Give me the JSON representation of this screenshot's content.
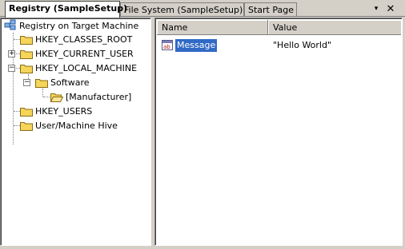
{
  "tabs": [
    {
      "label": "Registry (SampleSetup)",
      "active": true
    },
    {
      "label": "File System (SampleSetup)",
      "active": false
    },
    {
      "label": "Start Page",
      "active": false
    }
  ],
  "tab_controls": {
    "dropdown_icon": "▾",
    "close_icon": "✕"
  },
  "tree": {
    "root": "Registry on Target Machine",
    "items": [
      {
        "label": "HKEY_CLASSES_ROOT",
        "expander": ""
      },
      {
        "label": "HKEY_CURRENT_USER",
        "expander": "+"
      },
      {
        "label": "HKEY_LOCAL_MACHINE",
        "expander": "−"
      },
      {
        "label": "Software",
        "expander": "−"
      },
      {
        "label": "[Manufacturer]",
        "expander": ""
      },
      {
        "label": "HKEY_USERS",
        "expander": ""
      },
      {
        "label": "User/Machine Hive",
        "expander": ""
      }
    ]
  },
  "list": {
    "columns": [
      "Name",
      "Value"
    ],
    "rows": [
      {
        "name": "Message",
        "value": "\"Hello World\""
      }
    ]
  },
  "colors": {
    "chrome": "#d4d0c8",
    "selection": "#316ac5",
    "folder": "#f5d55a"
  }
}
